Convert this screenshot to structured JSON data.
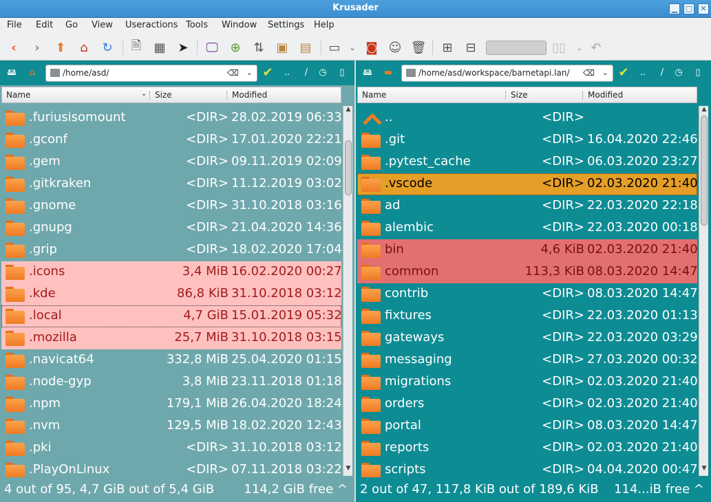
{
  "window": {
    "title": "Krusader"
  },
  "menu": [
    "File",
    "Edit",
    "Go",
    "View",
    "Useractions",
    "Tools",
    "Window",
    "Settings",
    "Help"
  ],
  "colors": {
    "left_bg": "#6fa8ac",
    "right_bg": "#0e8c94",
    "highlight_left": "#ffc0c0",
    "highlight_right": "#e27070",
    "current_row": "#e59e27"
  },
  "columns": {
    "name": "Name",
    "size": "Size",
    "modified": "Modified"
  },
  "left": {
    "path": "/home/asd/",
    "rows": [
      {
        "name": ".furiusisomount",
        "size": "<DIR>",
        "modified": "28.02.2019 06:33",
        "state": "normal"
      },
      {
        "name": ".gconf",
        "size": "<DIR>",
        "modified": "17.01.2020 22:21",
        "state": "normal"
      },
      {
        "name": ".gem",
        "size": "<DIR>",
        "modified": "09.11.2019 02:09",
        "state": "normal"
      },
      {
        "name": ".gitkraken",
        "size": "<DIR>",
        "modified": "11.12.2019 03:02",
        "state": "normal"
      },
      {
        "name": ".gnome",
        "size": "<DIR>",
        "modified": "31.10.2018 03:16",
        "state": "normal"
      },
      {
        "name": ".gnupg",
        "size": "<DIR>",
        "modified": "21.04.2020 14:36",
        "state": "normal"
      },
      {
        "name": ".grip",
        "size": "<DIR>",
        "modified": "18.02.2020 17:04",
        "state": "normal"
      },
      {
        "name": ".icons",
        "size": "3,4 MiB",
        "modified": "16.02.2020 00:27",
        "state": "hl"
      },
      {
        "name": ".kde",
        "size": "86,8 KiB",
        "modified": "31.10.2018 03:12",
        "state": "hl"
      },
      {
        "name": ".local",
        "size": "4,7 GiB",
        "modified": "15.01.2019 05:32",
        "state": "hl focus"
      },
      {
        "name": ".mozilla",
        "size": "25,7 MiB",
        "modified": "31.10.2018 03:15",
        "state": "hl"
      },
      {
        "name": ".navicat64",
        "size": "332,8 MiB",
        "modified": "25.04.2020 01:15",
        "state": "normal"
      },
      {
        "name": ".node-gyp",
        "size": "3,8 MiB",
        "modified": "23.11.2018 01:18",
        "state": "normal"
      },
      {
        "name": ".npm",
        "size": "179,1 MiB",
        "modified": "26.04.2020 18:24",
        "state": "normal"
      },
      {
        "name": ".nvm",
        "size": "129,5 MiB",
        "modified": "18.02.2020 12:43",
        "state": "normal"
      },
      {
        "name": ".pki",
        "size": "<DIR>",
        "modified": "31.10.2018 03:12",
        "state": "normal"
      },
      {
        "name": ".PlayOnLinux",
        "size": "<DIR>",
        "modified": "07.11.2018 03:22",
        "state": "normal"
      }
    ],
    "status_left": "4 out of 95, 4,7 GiB out of 5,4 GiB",
    "status_right": "114,2 GiB free ^"
  },
  "right": {
    "path": "/home/asd/workspace/barnetapi.lan/",
    "rows": [
      {
        "name": "..",
        "size": "<DIR>",
        "modified": "",
        "state": "up"
      },
      {
        "name": ".git",
        "size": "<DIR>",
        "modified": "16.04.2020 22:46",
        "state": "normal"
      },
      {
        "name": ".pytest_cache",
        "size": "<DIR>",
        "modified": "06.03.2020 23:27",
        "state": "normal"
      },
      {
        "name": ".vscode",
        "size": "<DIR>",
        "modified": "02.03.2020 21:40",
        "state": "cur"
      },
      {
        "name": "ad",
        "size": "<DIR>",
        "modified": "22.03.2020 22:18",
        "state": "normal"
      },
      {
        "name": "alembic",
        "size": "<DIR>",
        "modified": "22.03.2020 00:18",
        "state": "normal"
      },
      {
        "name": "bin",
        "size": "4,6 KiB",
        "modified": "02.03.2020 21:40",
        "state": "hlr"
      },
      {
        "name": "common",
        "size": "113,3 KiB",
        "modified": "08.03.2020 14:47",
        "state": "hlr"
      },
      {
        "name": "contrib",
        "size": "<DIR>",
        "modified": "08.03.2020 14:47",
        "state": "normal"
      },
      {
        "name": "fixtures",
        "size": "<DIR>",
        "modified": "22.03.2020 01:13",
        "state": "normal"
      },
      {
        "name": "gateways",
        "size": "<DIR>",
        "modified": "22.03.2020 03:29",
        "state": "normal"
      },
      {
        "name": "messaging",
        "size": "<DIR>",
        "modified": "27.03.2020 00:32",
        "state": "normal"
      },
      {
        "name": "migrations",
        "size": "<DIR>",
        "modified": "02.03.2020 21:40",
        "state": "normal"
      },
      {
        "name": "orders",
        "size": "<DIR>",
        "modified": "02.03.2020 21:40",
        "state": "normal"
      },
      {
        "name": "portal",
        "size": "<DIR>",
        "modified": "08.03.2020 14:47",
        "state": "normal"
      },
      {
        "name": "reports",
        "size": "<DIR>",
        "modified": "02.03.2020 21:40",
        "state": "normal"
      },
      {
        "name": "scripts",
        "size": "<DIR>",
        "modified": "04.04.2020 00:47",
        "state": "normal"
      }
    ],
    "status_left": "2 out of 47, 117,8 KiB out of 189,6 KiB",
    "status_right": "114...iB free ^"
  },
  "pathbar_buttons": {
    "dotdot": "..",
    "slash": "/"
  }
}
